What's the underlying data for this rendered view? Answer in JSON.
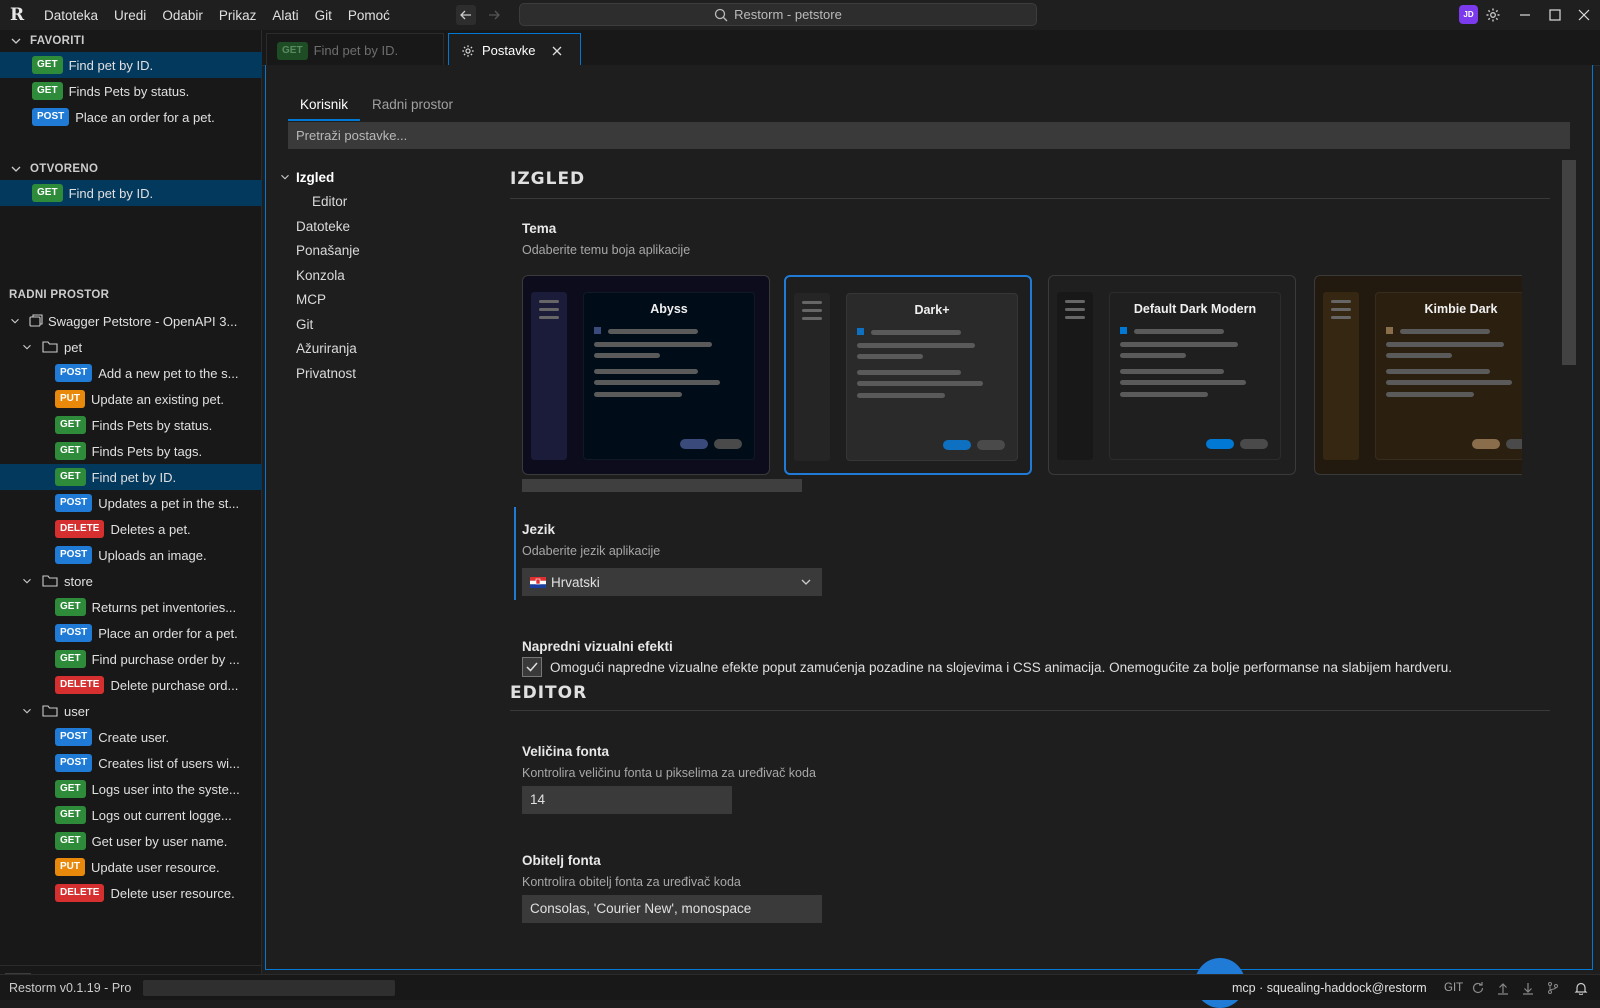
{
  "titlebar": {
    "menu": [
      "Datoteka",
      "Uredi",
      "Odabir",
      "Prikaz",
      "Alati",
      "Git",
      "Pomoć"
    ],
    "search_text": "Restorm - petstore",
    "avatar_initials": "JD"
  },
  "sidebar": {
    "favorites": {
      "title": "FAVORITI",
      "items": [
        {
          "method": "GET",
          "label": "Find pet by ID."
        },
        {
          "method": "GET",
          "label": "Finds Pets by status."
        },
        {
          "method": "POST",
          "label": "Place an order for a pet."
        }
      ]
    },
    "open": {
      "title": "OTVORENO",
      "items": [
        {
          "method": "GET",
          "label": "Find pet by ID."
        }
      ]
    },
    "workspace": {
      "title": "RADNI PROSTOR",
      "root": "Swagger Petstore - OpenAPI 3...",
      "folders": [
        {
          "name": "pet",
          "items": [
            {
              "method": "POST",
              "label": "Add a new pet to the s..."
            },
            {
              "method": "PUT",
              "label": "Update an existing pet."
            },
            {
              "method": "GET",
              "label": "Finds Pets by status."
            },
            {
              "method": "GET",
              "label": "Finds Pets by tags."
            },
            {
              "method": "GET",
              "label": "Find pet by ID."
            },
            {
              "method": "POST",
              "label": "Updates a pet in the st..."
            },
            {
              "method": "DELETE",
              "label": "Deletes a pet."
            },
            {
              "method": "POST",
              "label": "Uploads an image."
            }
          ]
        },
        {
          "name": "store",
          "items": [
            {
              "method": "GET",
              "label": "Returns pet inventories..."
            },
            {
              "method": "POST",
              "label": "Place an order for a pet."
            },
            {
              "method": "GET",
              "label": "Find purchase order by ..."
            },
            {
              "method": "DELETE",
              "label": "Delete purchase ord..."
            }
          ]
        },
        {
          "name": "user",
          "items": [
            {
              "method": "POST",
              "label": "Create user."
            },
            {
              "method": "POST",
              "label": "Creates list of users wi..."
            },
            {
              "method": "GET",
              "label": "Logs user into the syste..."
            },
            {
              "method": "GET",
              "label": "Logs out current logge..."
            },
            {
              "method": "GET",
              "label": "Get user by user name."
            },
            {
              "method": "PUT",
              "label": "Update user resource."
            },
            {
              "method": "DELETE",
              "label": "Delete user resource."
            }
          ]
        }
      ]
    }
  },
  "tabs": [
    {
      "badge": "GET",
      "label": "Find pet by ID."
    },
    {
      "label": "Postavke"
    }
  ],
  "settings": {
    "tabs": [
      "Korisnik",
      "Radni prostor"
    ],
    "search_placeholder": "Pretraži postavke...",
    "nav": {
      "group": "Izgled",
      "sub": "Editor",
      "items": [
        "Datoteke",
        "Ponašanje",
        "Konzola",
        "MCP",
        "Git",
        "Ažuriranja",
        "Privatnost"
      ]
    },
    "appearance": {
      "heading": "IZGLED",
      "theme_title": "Tema",
      "theme_desc": "Odaberite temu boja aplikacije",
      "themes": [
        {
          "name": "Abyss",
          "bg": "#0c0c1c",
          "side": "#1b1b3a",
          "panel": "#000c18",
          "accent": "#3a4a7a"
        },
        {
          "name": "Dark+",
          "bg": "#1e1e1e",
          "side": "#252526",
          "panel": "#2a2a2a",
          "accent": "#0e70c0"
        },
        {
          "name": "Default Dark Modern",
          "bg": "#1f1f1f",
          "side": "#181818",
          "panel": "#1f1f1f",
          "accent": "#0078d4"
        },
        {
          "name": "Kimbie Dark",
          "bg": "#221a0f",
          "side": "#362712",
          "panel": "#2b1f10",
          "accent": "#8a6d4a"
        }
      ],
      "lang_title": "Jezik",
      "lang_desc": "Odaberite jezik aplikacije",
      "lang_value": "Hrvatski",
      "effects_title": "Napredni vizualni efekti",
      "effects_label": "Omogući napredne vizualne efekte poput zamućenja pozadine na slojevima i CSS animacija. Onemogućite za bolje performanse na slabijem hardveru.",
      "effects_checked": true
    },
    "editor": {
      "heading": "EDITOR",
      "font_size_title": "Veličina fonta",
      "font_size_desc": "Kontrolira veličinu fonta u pikselima za uređivač koda",
      "font_size_value": "14",
      "font_family_title": "Obitelj fonta",
      "font_family_desc": "Kontrolira obitelj fonta za uređivač koda",
      "font_family_value": "Consolas, 'Courier New', monospace"
    }
  },
  "statusbar": {
    "version": "Restorm v0.1.19 - Pro",
    "mcp": "mcp · squealing-haddock@restorm",
    "git": "GIT"
  },
  "colors": {
    "accent": "#0078d4",
    "get": "#2e8b3a",
    "post": "#1f7bd6",
    "put": "#e8890c",
    "delete": "#d62f2f"
  }
}
